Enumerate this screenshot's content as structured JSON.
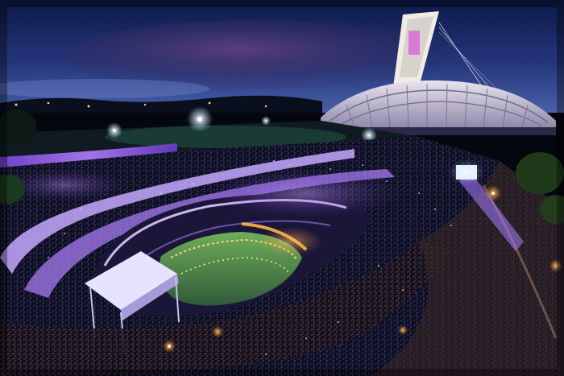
{
  "photo": {
    "subject": "crowd-at-night-event",
    "palette": {
      "sky_top": "#0d1a4a",
      "sky_mid": "#24357a",
      "sky_horizon": "#4a5fa8",
      "cloud": "#3a2c5e",
      "ground": "#05070f",
      "purple_glow": "#8a5cff",
      "violet_wall": "#b07aff",
      "tower": "#f0ece4",
      "tower_accent": "#d96ad3",
      "amber_light": "#ffb347",
      "warm_light": "#ffd27a",
      "green_stage": "#6fae5a",
      "screen_light": "#e8f2ff"
    }
  }
}
